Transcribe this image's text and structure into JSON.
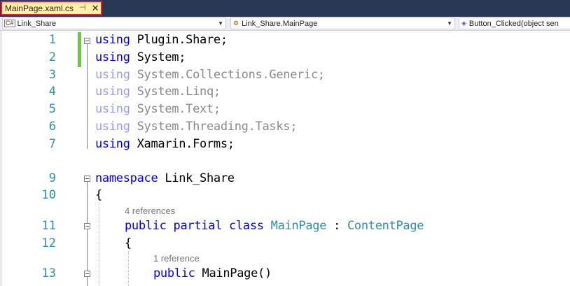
{
  "tab": {
    "title": "MainPage.xaml.cs",
    "pin_glyph": "⊣",
    "close_glyph": "✕"
  },
  "navbar": {
    "project": "Link_Share",
    "type": "Link_Share.MainPage",
    "member": "Button_Clicked(object sen"
  },
  "lines": [
    {
      "num": "1",
      "parts": [
        {
          "k": "kw",
          "t": "using"
        },
        {
          "k": "ns",
          "t": " Plugin.Share;"
        }
      ]
    },
    {
      "num": "2",
      "parts": [
        {
          "k": "kw",
          "t": "using"
        },
        {
          "k": "ns",
          "t": " System;"
        }
      ]
    },
    {
      "num": "3",
      "parts": [
        {
          "k": "kw",
          "t": "using"
        },
        {
          "k": "ns",
          "t": " System.Collections.Generic;"
        }
      ]
    },
    {
      "num": "4",
      "parts": [
        {
          "k": "kw",
          "t": "using"
        },
        {
          "k": "ns",
          "t": " System.Linq;"
        }
      ]
    },
    {
      "num": "5",
      "parts": [
        {
          "k": "kw",
          "t": "using"
        },
        {
          "k": "ns",
          "t": " System.Text;"
        }
      ]
    },
    {
      "num": "6",
      "parts": [
        {
          "k": "kw",
          "t": "using"
        },
        {
          "k": "ns",
          "t": " System.Threading.Tasks;"
        }
      ]
    },
    {
      "num": "7",
      "parts": [
        {
          "k": "kw",
          "t": "using"
        },
        {
          "k": "ns",
          "t": " Xamarin.Forms;"
        }
      ]
    },
    {
      "num": "9",
      "parts": [
        {
          "k": "kw",
          "t": "namespace"
        },
        {
          "k": "ns",
          "t": " Link_Share"
        }
      ]
    },
    {
      "num": "10",
      "parts": [
        {
          "k": "ns",
          "t": "{"
        }
      ]
    },
    {
      "num": "11",
      "parts": [
        {
          "k": "kw",
          "t": "public"
        },
        {
          "k": "ns",
          "t": " "
        },
        {
          "k": "kw",
          "t": "partial"
        },
        {
          "k": "ns",
          "t": " "
        },
        {
          "k": "kw",
          "t": "class"
        },
        {
          "k": "ns",
          "t": " "
        },
        {
          "k": "ty",
          "t": "MainPage"
        },
        {
          "k": "ns",
          "t": " : "
        },
        {
          "k": "ty",
          "t": "ContentPage"
        }
      ]
    },
    {
      "num": "12",
      "parts": [
        {
          "k": "ns",
          "t": "{"
        }
      ]
    },
    {
      "num": "13",
      "parts": [
        {
          "k": "kw",
          "t": "public"
        },
        {
          "k": "ns",
          "t": " MainPage()"
        }
      ]
    }
  ],
  "codelens": {
    "class_refs": "4 references",
    "ctor_refs": "1 reference"
  }
}
